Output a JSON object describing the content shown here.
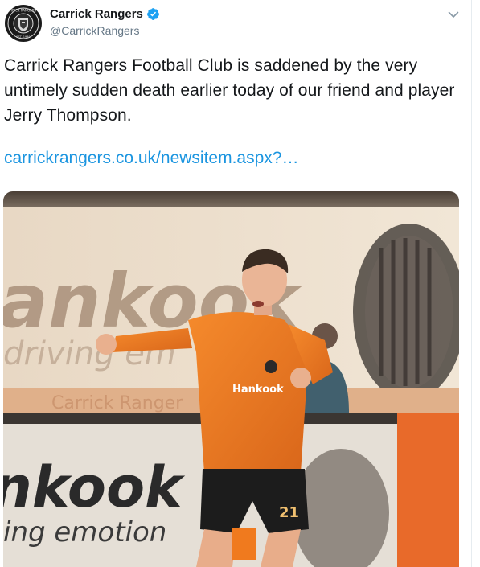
{
  "account": {
    "display_name": "Carrick Rangers",
    "handle": "@CarrickRangers",
    "verified": true,
    "avatar_icon": "club-crest-icon",
    "crest_text_top": "CARRICK RANGERS FC",
    "crest_text_bottom": "EST. 1939"
  },
  "tweet": {
    "text": "Carrick Rangers Football Club is saddened by the very untimely sudden death earlier today of our friend and player Jerry Thompson.",
    "link_text": "carrickrangers.co.uk/newsitem.aspx?…",
    "menu_icon": "chevron-down-icon"
  },
  "media": {
    "image_subject": "player-celebrating-photo",
    "banner_top_text": "ankook",
    "banner_top_sub": "driving em",
    "banner_mid_text": "Carrick Ranger",
    "banner_bottom_text": "nkook",
    "banner_bottom_sub": "ing emotion",
    "shirt_sponsor": "Hankook",
    "shorts_number": "21"
  },
  "colors": {
    "link": "#1b95e0",
    "verified": "#1da1f2",
    "kit_orange": "#f07a1e",
    "handle_grey": "#657786"
  }
}
